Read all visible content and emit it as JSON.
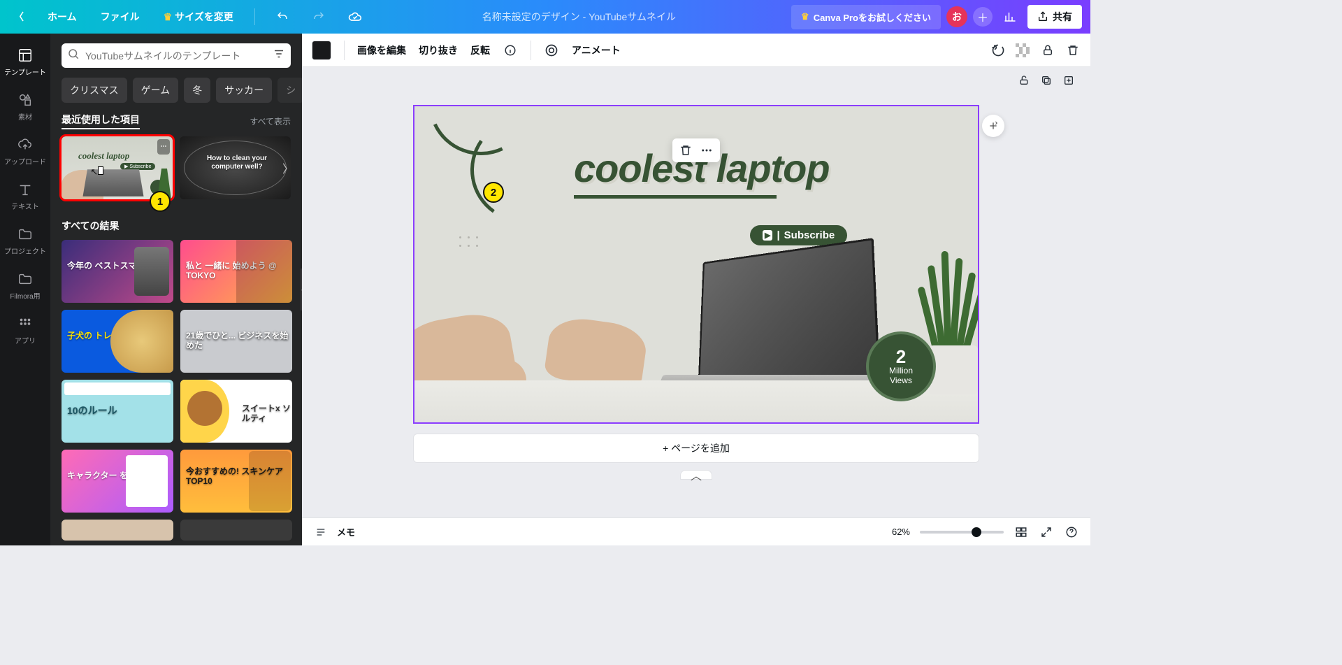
{
  "topbar": {
    "home": "ホーム",
    "file": "ファイル",
    "resize": "サイズを変更",
    "title": "名称未設定のデザイン - YouTubeサムネイル",
    "pro": "Canva Proをお試しください",
    "avatar": "お",
    "share": "共有"
  },
  "rail": [
    {
      "label": "テンプレート"
    },
    {
      "label": "素材"
    },
    {
      "label": "アップロード"
    },
    {
      "label": "テキスト"
    },
    {
      "label": "プロジェクト"
    },
    {
      "label": "Filmora用"
    },
    {
      "label": "アプリ"
    }
  ],
  "panel": {
    "search_placeholder": "YouTubeサムネイルのテンプレート",
    "chips": [
      "クリスマス",
      "ゲーム",
      "冬",
      "サッカー",
      "シ"
    ],
    "recent_title": "最近使用した項目",
    "see_all": "すべて表示",
    "results_title": "すべての結果",
    "recent_cards": [
      {
        "t": "coolest laptop",
        "sub": ""
      },
      {
        "t": "How to clean your\ncomputer well?"
      }
    ],
    "result_cards": [
      {
        "t": "今年の\nベストスマホ"
      },
      {
        "t": "私と\n一緒に\n始めよう\n@ TOKYO"
      },
      {
        "t": "子犬の\nトレーニング\n方法"
      },
      {
        "t": "21歳でひと...\nビジネスを始めた"
      },
      {
        "t": "10のルール"
      },
      {
        "t": "スイートx\nソルティ"
      },
      {
        "t": "キャラクター\nを作ろう"
      },
      {
        "t": "今おすすめの!\nスキンケア\nTOP10"
      }
    ]
  },
  "markers": {
    "one": "1",
    "two": "2"
  },
  "ctxbar": {
    "edit_image": "画像を編集",
    "crop": "切り抜き",
    "flip": "反転",
    "animate": "アニメート"
  },
  "canvas": {
    "title": "coolest laptop",
    "subscribe": "Subscribe",
    "views_n": "2",
    "views_t1": "Million",
    "views_t2": "Views"
  },
  "add_page": "+ ページを追加",
  "bottom": {
    "notes": "メモ",
    "zoom": "62%",
    "slider_pct": 62
  }
}
